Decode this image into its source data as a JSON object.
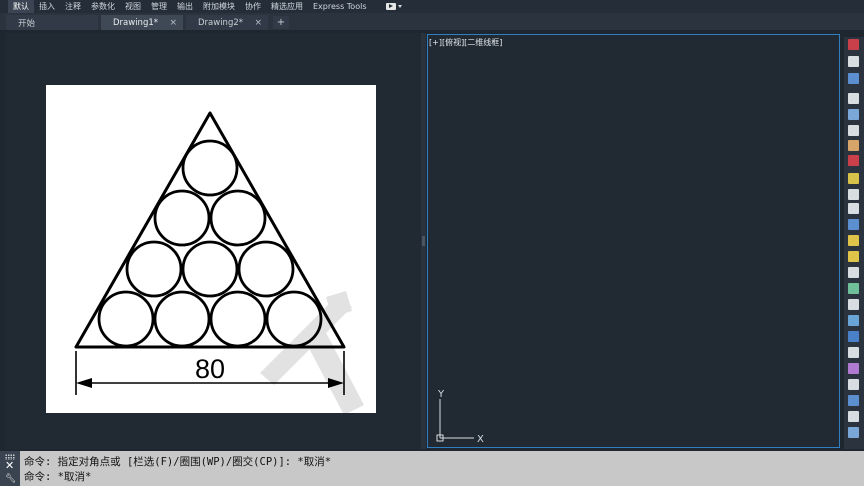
{
  "ribbon": {
    "tabs": [
      "默认",
      "插入",
      "注释",
      "参数化",
      "视图",
      "管理",
      "输出",
      "附加模块",
      "协作",
      "精选应用",
      "Express Tools"
    ],
    "active_index": 0
  },
  "file_tabs": {
    "start": "开始",
    "drawing1": "Drawing1*",
    "drawing2": "Drawing2*",
    "add": "+",
    "close": "×"
  },
  "drawing": {
    "dimension_text": "80"
  },
  "viewport": {
    "label": "[+][俯视][二维线框]",
    "ucs_x": "X",
    "ucs_y": "Y"
  },
  "command_line": {
    "line1": "命令: 指定对角点或 [栏选(F)/圈围(WP)/圈交(CP)]: *取消*",
    "line2": "命令: *取消*"
  },
  "colors": {
    "background": "#1e2630",
    "viewport_border": "#2f7fc1",
    "command_bg": "#c8c8c8"
  }
}
